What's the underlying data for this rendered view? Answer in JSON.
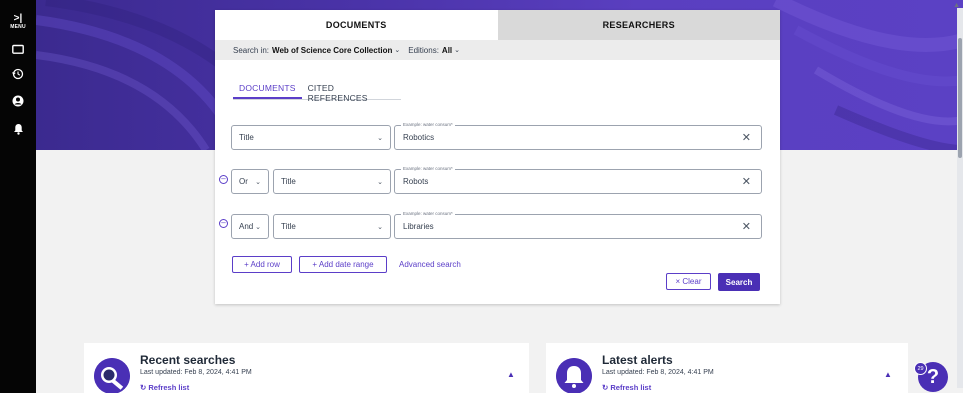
{
  "rail": {
    "menu_arrow": ">|",
    "menu_label": "MENU",
    "icons": [
      "folder-icon",
      "history-icon",
      "account-icon",
      "bell-icon"
    ]
  },
  "tabs": {
    "documents": "DOCUMENTS",
    "researchers": "RESEARCHERS"
  },
  "search_in": {
    "label": "Search in:",
    "collection": "Web of Science Core Collection",
    "editions_label": "Editions:",
    "editions_value": "All"
  },
  "subtabs": {
    "documents": "DOCUMENTS",
    "cited_references": "CITED REFERENCES"
  },
  "rows": [
    {
      "operator": "",
      "field": "Title",
      "placeholder": "Example: water consum*",
      "value": "Robotics"
    },
    {
      "operator": "Or",
      "field": "Title",
      "placeholder": "Example: water consum*",
      "value": "Robots"
    },
    {
      "operator": "And",
      "field": "Title",
      "placeholder": "Example: water consum*",
      "value": "Libraries"
    }
  ],
  "actions": {
    "add_row": "+ Add row",
    "add_date_range": "+ Add date range",
    "advanced_search": "Advanced search",
    "clear": "× Clear",
    "search": "Search"
  },
  "recent_searches": {
    "title": "Recent searches",
    "updated": "Last updated: Feb 8, 2024, 4:41 PM",
    "refresh": "↻ Refresh list"
  },
  "latest_alerts": {
    "title": "Latest alerts",
    "updated": "Last updated: Feb 8, 2024, 4:41 PM",
    "refresh": "↻ Refresh list"
  },
  "help": {
    "badge": "29",
    "label": "?"
  },
  "colors": {
    "accent": "#5b3ec8",
    "primary_button": "#4a2fb5",
    "banner": "#4a33a8",
    "rail": "#050505"
  }
}
